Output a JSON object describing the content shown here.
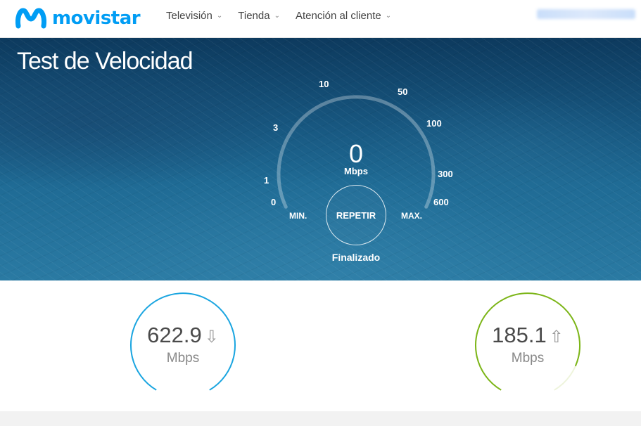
{
  "brand": {
    "name": "movistar",
    "color": "#019df4"
  },
  "nav": {
    "items": [
      {
        "label": "Televisión",
        "icon": "chevron-down-icon"
      },
      {
        "label": "Tienda",
        "icon": "chevron-down-icon"
      },
      {
        "label": "Atención al cliente",
        "icon": "chevron-down-icon"
      }
    ]
  },
  "hero": {
    "title": "Test de Velocidad"
  },
  "gauge": {
    "scale_labels": [
      "0",
      "1",
      "3",
      "10",
      "50",
      "100",
      "300",
      "600"
    ],
    "min_label": "MIN.",
    "max_label": "MAX.",
    "value": "0",
    "unit": "Mbps",
    "repeat_label": "REPETIR",
    "status": "Finalizado"
  },
  "results": {
    "download": {
      "value": "622.9",
      "unit": "Mbps",
      "icon": "arrow-down-icon",
      "color": "#1aa5e0",
      "level": 1.0
    },
    "upload": {
      "value": "185.1",
      "unit": "Mbps",
      "icon": "arrow-up-icon",
      "color": "#7cb518",
      "level": 0.88
    }
  }
}
